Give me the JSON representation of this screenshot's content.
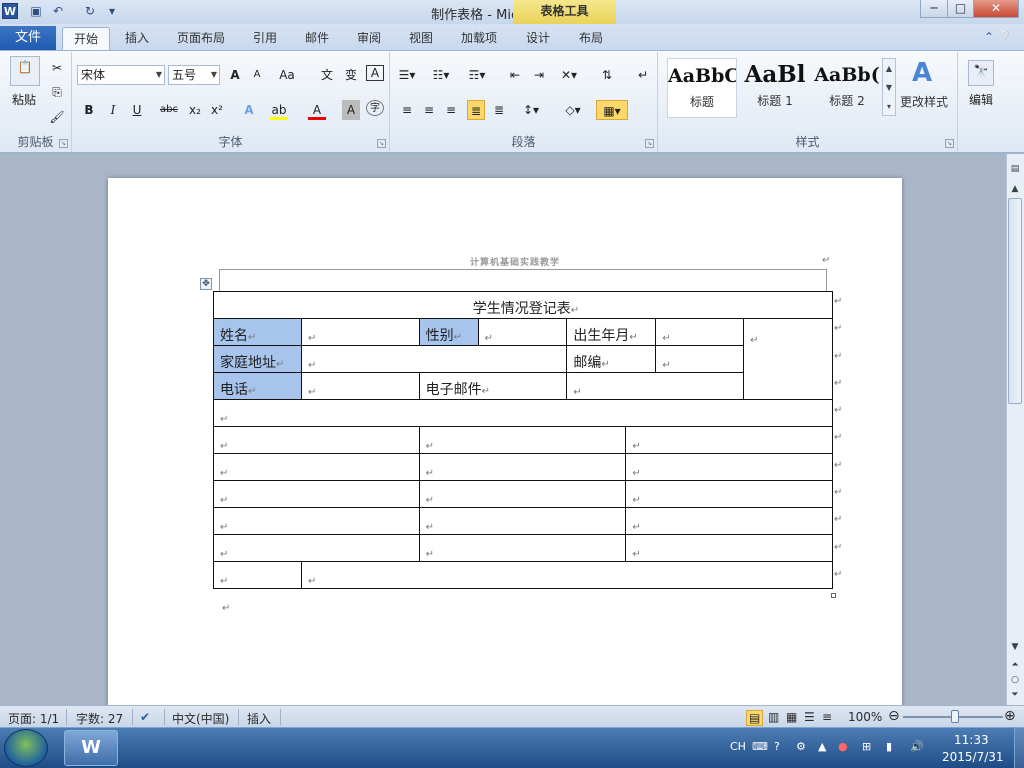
{
  "window": {
    "title": "制作表格 - Microsoft Word",
    "context_tab": "表格工具",
    "controls": {
      "minimize": "─",
      "maximize": "□",
      "close": "✕"
    }
  },
  "quick_access": {
    "app_icon": "W",
    "items": [
      "save-icon",
      "undo-icon",
      "redo-icon",
      "customize-icon"
    ]
  },
  "tabs": [
    "文件",
    "开始",
    "插入",
    "页面布局",
    "引用",
    "邮件",
    "审阅",
    "视图",
    "加载项",
    "设计",
    "布局"
  ],
  "active_tab": "开始",
  "ribbon": {
    "clipboard": {
      "label": "剪贴板",
      "paste": "粘贴"
    },
    "font": {
      "label": "字体",
      "font_name": "宋体",
      "font_size": "五号",
      "buttons": {
        "grow": "A",
        "shrink": "A",
        "case": "Aa",
        "bold": "B",
        "italic": "I",
        "underline": "U",
        "strike": "abc",
        "sub": "x₂",
        "sup": "x²",
        "color": "A",
        "border_char": "A",
        "enclose": "字"
      }
    },
    "paragraph": {
      "label": "段落"
    },
    "styles": {
      "label": "样式",
      "items": [
        {
          "sample": "AaBbC",
          "name": "标题"
        },
        {
          "sample": "AaBl",
          "name": "标题 1"
        },
        {
          "sample": "AaBb(",
          "name": "标题 2"
        }
      ],
      "change": "更改样式"
    },
    "editing": {
      "label": "编辑"
    }
  },
  "document": {
    "header_text": "计算机基础实践教学",
    "table": {
      "title": "学生情况登记表",
      "name_label": "姓名",
      "gender_label": "性别",
      "birth_label": "出生年月",
      "address_label": "家庭地址",
      "zip_label": "邮编",
      "phone_label": "电话",
      "email_label": "电子邮件"
    },
    "para_mark": "↵"
  },
  "status_bar": {
    "page": "页面: 1/1",
    "words": "字数: 27",
    "language": "中文(中国)",
    "mode": "插入",
    "zoom": "100%"
  },
  "taskbar": {
    "word_button": "W",
    "ime": "CH",
    "time": "11:33",
    "date": "2015/7/31"
  }
}
